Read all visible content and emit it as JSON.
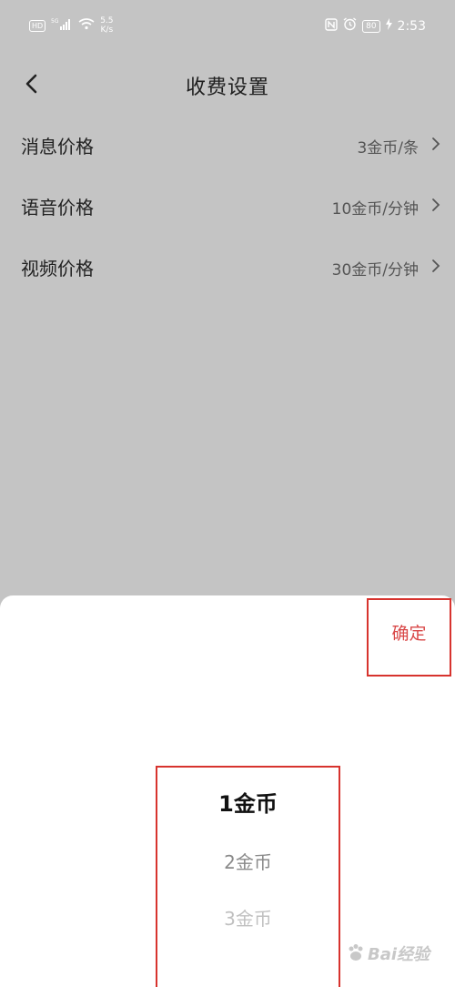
{
  "status_bar": {
    "hd": "HD",
    "signal_label": "5G",
    "speed": "5.5",
    "speed_unit": "K/s",
    "battery": "80",
    "time": "2:53"
  },
  "header": {
    "title": "收费设置"
  },
  "rows": [
    {
      "label": "消息价格",
      "value": "3金币/条"
    },
    {
      "label": "语音价格",
      "value": "10金币/分钟"
    },
    {
      "label": "视频价格",
      "value": "30金币/分钟"
    }
  ],
  "sheet": {
    "confirm_label": "确定",
    "options": [
      "1金币",
      "2金币",
      "3金币"
    ],
    "selected": "1金币"
  },
  "watermark": {
    "text": "Bai经验"
  },
  "colors": {
    "accent": "#d94848",
    "highlight_border": "#d7332e",
    "overlay": "#c4c4c4"
  }
}
